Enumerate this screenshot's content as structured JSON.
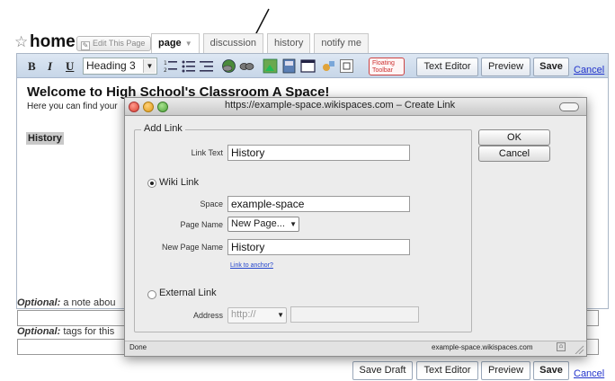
{
  "page": {
    "title": "home",
    "edit_button": "Edit This Page",
    "tabs": [
      {
        "label": "page",
        "active": true,
        "has_dropdown": true
      },
      {
        "label": "discussion",
        "active": false
      },
      {
        "label": "history",
        "active": false
      },
      {
        "label": "notify me",
        "active": false
      }
    ]
  },
  "toolbar": {
    "bold": "B",
    "italic": "I",
    "underline": "U",
    "heading_value": "Heading 3",
    "floating_toolbar": "Floating Toolbar",
    "text_editor": "Text Editor",
    "preview": "Preview",
    "save": "Save",
    "cancel": "Cancel"
  },
  "content": {
    "heading": "Welcome to High School's Classroom A Space!",
    "intro": "Here you can find your",
    "highlighted": "History"
  },
  "optional": {
    "note_label_em": "Optional:",
    "note_label_rest": " a note abou",
    "tags_label_em": "Optional:",
    "tags_label_rest": " tags for this"
  },
  "bottom": {
    "save_draft": "Save Draft",
    "text_editor": "Text Editor",
    "preview": "Preview",
    "save": "Save",
    "cancel": "Cancel"
  },
  "dialog": {
    "title": "https://example-space.wikispaces.com – Create Link",
    "group_title": "Add Link",
    "link_text_label": "Link Text",
    "link_text_value": "History",
    "wiki_link_label": "Wiki Link",
    "space_label": "Space",
    "space_value": "example-space",
    "page_name_label": "Page Name",
    "page_name_value": "New Page...",
    "new_page_name_label": "New Page Name",
    "new_page_name_value": "History",
    "link_to_anchor": "Link to anchor?",
    "external_link_label": "External Link",
    "address_label": "Address",
    "address_protocol": "http://",
    "address_value": "",
    "ok": "OK",
    "cancel": "Cancel",
    "status_left": "Done",
    "status_right": "example-space.wikispaces.com",
    "selected_link_type": "wiki"
  },
  "colors": {
    "toolbar_top": "#dde7f3",
    "toolbar_bottom": "#c7d6e8",
    "link": "#2233cc",
    "floating_border": "#cc4444"
  }
}
